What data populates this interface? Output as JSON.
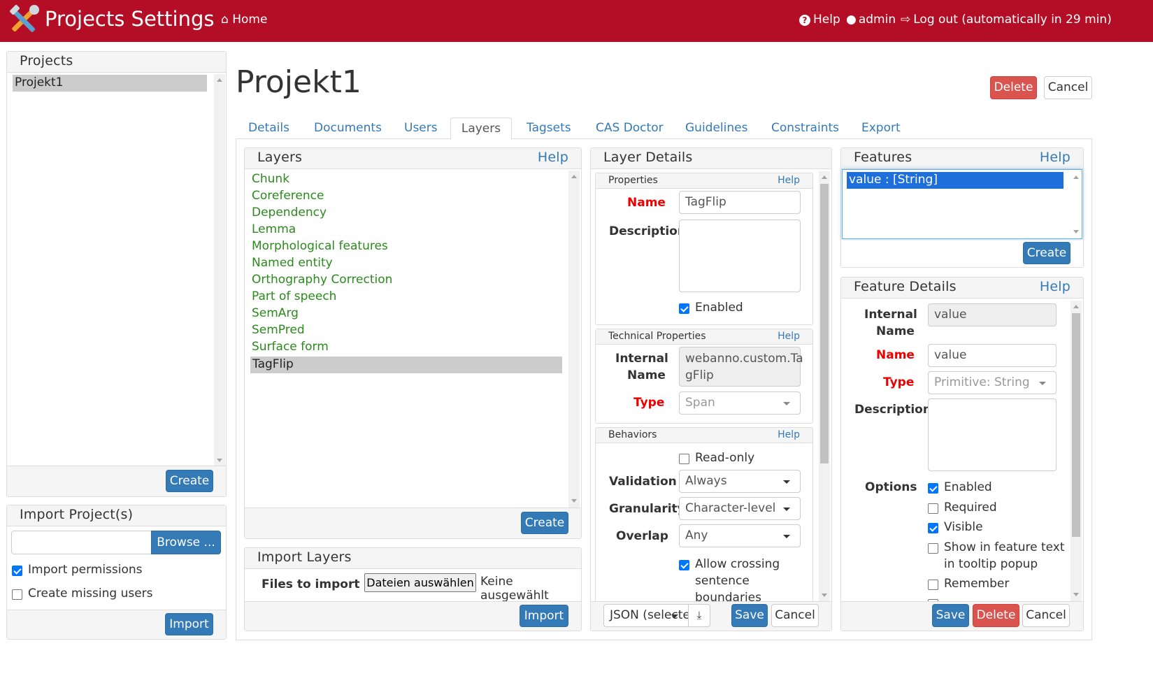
{
  "topbar": {
    "title": "Projects Settings",
    "home": "Home",
    "help": "Help",
    "user": "admin",
    "logout": "Log out (automatically in 29 min)"
  },
  "projects_panel": {
    "title": "Projects",
    "items": [
      "Projekt1"
    ],
    "create": "Create"
  },
  "import_panel": {
    "title": "Import Project(s)",
    "browse": "Browse ...",
    "file_value": "",
    "import_permissions": "Import permissions",
    "import_permissions_checked": true,
    "create_missing_users": "Create missing users",
    "create_missing_users_checked": false,
    "import": "Import"
  },
  "project": {
    "name": "Projekt1",
    "delete": "Delete",
    "cancel": "Cancel"
  },
  "tabs": [
    "Details",
    "Documents",
    "Users",
    "Layers",
    "Tagsets",
    "CAS Doctor",
    "Guidelines",
    "Constraints",
    "Export"
  ],
  "active_tab": "Layers",
  "layers_panel": {
    "title": "Layers",
    "help": "Help",
    "items": [
      "Chunk",
      "Coreference",
      "Dependency",
      "Lemma",
      "Morphological features",
      "Named entity",
      "Orthography Correction",
      "Part of speech",
      "SemArg",
      "SemPred",
      "Surface form",
      "TagFlip"
    ],
    "selected": "TagFlip",
    "create": "Create"
  },
  "import_layers": {
    "title": "Import Layers",
    "files_label": "Files to import",
    "choose": "Dateien auswählen",
    "none_selected": "Keine ausgewählt",
    "import": "Import"
  },
  "layer_details": {
    "title": "Layer Details",
    "properties": {
      "title": "Properties",
      "help": "Help",
      "name_label": "Name",
      "name_value": "TagFlip",
      "description_label": "Description",
      "enabled": "Enabled",
      "enabled_checked": true
    },
    "technical": {
      "title": "Technical Properties",
      "help": "Help",
      "internal_name_label_1": "Internal",
      "internal_name_label_2": "Name",
      "internal_name_1": "webanno.custom.Ta",
      "internal_name_2": "gFlip",
      "type_label": "Type",
      "type_value": "Span"
    },
    "behaviors": {
      "title": "Behaviors",
      "help": "Help",
      "read_only": "Read-only",
      "read_only_checked": false,
      "validation_label": "Validation",
      "validation_value": "Always",
      "granularity_label": "Granularity",
      "granularity_value": "Character-level",
      "overlap_label": "Overlap",
      "overlap_value": "Any",
      "allow_crossing_1": "Allow crossing",
      "allow_crossing_2": "sentence",
      "allow_crossing_3": "boundaries",
      "allow_crossing_checked": true
    },
    "export_format": "JSON (selecte",
    "save": "Save",
    "cancel": "Cancel"
  },
  "features_panel": {
    "title": "Features",
    "help": "Help",
    "items": [
      "value : [String]"
    ],
    "create": "Create"
  },
  "feature_details": {
    "title": "Feature Details",
    "help": "Help",
    "internal_name_label_1": "Internal",
    "internal_name_label_2": "Name",
    "internal_name_value": "value",
    "name_label": "Name",
    "name_value": "value",
    "type_label": "Type",
    "type_value": "Primitive: String",
    "description_label": "Description",
    "options_label": "Options",
    "options": [
      {
        "label": "Enabled",
        "checked": true
      },
      {
        "label": "Required",
        "checked": false
      },
      {
        "label": "Visible",
        "checked": true
      },
      {
        "label": "Show in feature text",
        "checked": false
      },
      {
        "label": "in tooltip popup",
        "checked": false
      },
      {
        "label": "Remember",
        "checked": false
      }
    ],
    "save": "Save",
    "delete": "Delete",
    "cancel": "Cancel"
  },
  "colors": {
    "topbar": "#b30e25",
    "primary": "#337ab7",
    "danger": "#d9534f",
    "layer_text": "#2a8a1c",
    "required_label": "#ee0000"
  }
}
